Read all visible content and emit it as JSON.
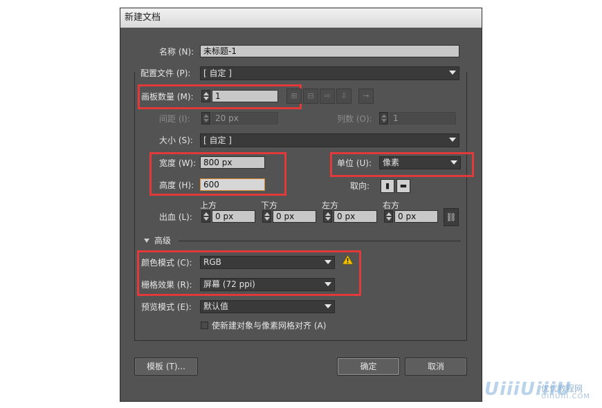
{
  "window": {
    "title": "新建文档"
  },
  "name": {
    "label": "名称 (N):",
    "value": "未标题-1"
  },
  "profile": {
    "label": "配置文件 (P):",
    "value": "[ 自定 ]"
  },
  "artboards": {
    "label": "画板数量 (M):",
    "value": "1",
    "spacing_label": "间距 (I):",
    "spacing_value": "20 px",
    "columns_label": "列数 (O):",
    "columns_value": "1",
    "arrange_icons": [
      "grid-by-row-icon",
      "grid-by-column-icon",
      "arrange-by-row-icon",
      "arrange-by-column-icon",
      "right-to-left-icon"
    ]
  },
  "size": {
    "label": "大小 (S):",
    "value": "[ 自定 ]"
  },
  "width": {
    "label": "宽度 (W):",
    "value": "800 px"
  },
  "height": {
    "label": "高度 (H):",
    "value": "600"
  },
  "units": {
    "label": "单位 (U):",
    "value": "像素"
  },
  "orientation": {
    "label": "取向:",
    "icons": [
      "portrait-icon",
      "landscape-icon"
    ]
  },
  "bleed": {
    "label": "出血 (L):",
    "top_label": "上方",
    "top_value": "0 px",
    "bottom_label": "下方",
    "bottom_value": "0 px",
    "left_label": "左方",
    "left_value": "0 px",
    "right_label": "右方",
    "right_value": "0 px"
  },
  "advanced": {
    "label": "高级",
    "color_mode_label": "颜色模式 (C):",
    "color_mode_value": "RGB",
    "raster_label": "栅格效果 (R):",
    "raster_value": "屏幕 (72 ppi)",
    "preview_label": "预览模式 (E):",
    "preview_value": "默认值",
    "align_checkbox_label": "使新建对象与像素网格对齐 (A)",
    "align_checked": false
  },
  "buttons": {
    "templates": "模板 (T)...",
    "ok": "确定",
    "cancel": "取消"
  },
  "watermark": {
    "logo": "UiiiUiiiU",
    "site_name": "优优教程网",
    "site_url": "UIIIUIII.COM"
  },
  "colors": {
    "dialog_bg": "#535353",
    "highlight": "#e23a3a",
    "warning": "#f2c200",
    "focus": "#d9892b"
  }
}
